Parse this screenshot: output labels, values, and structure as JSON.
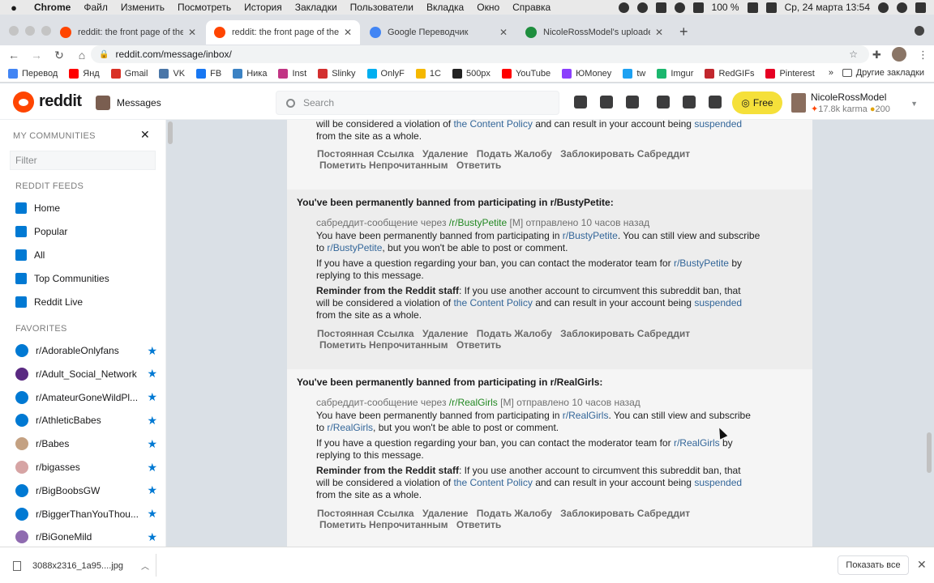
{
  "menubar": {
    "app": "Chrome",
    "items": [
      "Файл",
      "Изменить",
      "Посмотреть",
      "История",
      "Закладки",
      "Пользователи",
      "Вкладка",
      "Окно",
      "Справка"
    ],
    "battery": "100 %",
    "datetime": "Ср, 24 марта  13:54"
  },
  "tabs": [
    {
      "title": "reddit: the front page of the int",
      "color": "#ff4500"
    },
    {
      "title": "reddit: the front page of the int",
      "color": "#ff4500"
    },
    {
      "title": "Google Переводчик",
      "color": "#4285f4"
    },
    {
      "title": "NicoleRossModel's uploaded in",
      "color": "#1e8e3e"
    }
  ],
  "address": {
    "url": "reddit.com/message/inbox/"
  },
  "bookmarks": [
    {
      "label": "Перевод",
      "color": "#4285f4"
    },
    {
      "label": "Янд",
      "color": "#ff0000"
    },
    {
      "label": "Gmail",
      "color": "#d93025"
    },
    {
      "label": "VK",
      "color": "#4a76a8"
    },
    {
      "label": "FB",
      "color": "#1877f2"
    },
    {
      "label": "Ника",
      "color": "#3b82c4"
    },
    {
      "label": "Inst",
      "color": "#c13584"
    },
    {
      "label": "Slinky",
      "color": "#d32f2f"
    },
    {
      "label": "OnlyF",
      "color": "#00aff0"
    },
    {
      "label": "1С",
      "color": "#f5b800"
    },
    {
      "label": "500px",
      "color": "#222222"
    },
    {
      "label": "YouTube",
      "color": "#ff0000"
    },
    {
      "label": "ЮMoney",
      "color": "#8b3ffd"
    },
    {
      "label": "tw",
      "color": "#1da1f2"
    },
    {
      "label": "Imgur",
      "color": "#1bb76e"
    },
    {
      "label": "RedGIFs",
      "color": "#c1272d"
    },
    {
      "label": "Pinterest",
      "color": "#e60023"
    }
  ],
  "bookmarks_more": "»",
  "bookmarks_other": "Другие закладки",
  "reddit": {
    "logo_text": "reddit",
    "page": "Messages",
    "search_placeholder": "Search",
    "free_label": "Free",
    "username": "NicoleRossModel",
    "karma": "17.8k karma",
    "coins": "200"
  },
  "sidebar": {
    "my_communities": "MY COMMUNITIES",
    "filter_placeholder": "Filter",
    "feeds_title": "REDDIT FEEDS",
    "feeds": [
      "Home",
      "Popular",
      "All",
      "Top Communities",
      "Reddit Live"
    ],
    "favorites_title": "FAVORITES",
    "favorites": [
      {
        "name": "r/AdorableOnlyfans",
        "color": "#0079d3"
      },
      {
        "name": "r/Adult_Social_Network",
        "color": "#5a2a82"
      },
      {
        "name": "r/AmateurGoneWildPl...",
        "color": "#0079d3"
      },
      {
        "name": "r/AthleticBabes",
        "color": "#0079d3"
      },
      {
        "name": "r/Babes",
        "color": "#c4a182"
      },
      {
        "name": "r/bigasses",
        "color": "#d6a4a4"
      },
      {
        "name": "r/BigBoobsGW",
        "color": "#0079d3"
      },
      {
        "name": "r/BiggerThanYouThou...",
        "color": "#0079d3"
      },
      {
        "name": "r/BiGoneMild",
        "color": "#8f6bb0"
      }
    ]
  },
  "messages": [
    {
      "partial": true,
      "reminder_tail": "will be considered a violation of",
      "content_policy": "the Content Policy",
      "reminder_mid": "and can result in your account being",
      "suspended": "suspended",
      "reminder_end": "from the site as a whole.",
      "actions": [
        "Постоянная Ссылка",
        "Удаление",
        "Подать Жалобу",
        "Заблокировать Сабреддит"
      ],
      "actions2": [
        "Пометить Непрочитанным",
        "Ответить"
      ]
    },
    {
      "subject": "You've been permanently banned from participating in r/BustyPetite:",
      "meta_prefix": "сабреддит-сообщение через",
      "sub": "/r/BustyPetite",
      "meta_suffix": "[M] отправлено 10 часов назад",
      "body1a": "You have been permanently banned from participating in",
      "sublink": "r/BustyPetite",
      "body1b": ". You can still view and subscribe",
      "body2a": "to",
      "body2b": ", but you won't be able to post or comment.",
      "body3a": "If you have a question regarding your ban, you can contact the moderator team for",
      "body3b": "by",
      "body4": "replying to this message.",
      "reminder_label": "Reminder from the Reddit staff",
      "reminder": ": If you use another account to circumvent this subreddit ban, that",
      "reminder_tail": "will be considered a violation of",
      "content_policy": "the Content Policy",
      "reminder_mid": "and can result in your account being",
      "suspended": "suspended",
      "reminder_end": "from the site as a whole.",
      "actions": [
        "Постоянная Ссылка",
        "Удаление",
        "Подать Жалобу",
        "Заблокировать Сабреддит"
      ],
      "actions2": [
        "Пометить Непрочитанным",
        "Ответить"
      ]
    },
    {
      "subject": "You've been permanently banned from participating in r/RealGirls:",
      "meta_prefix": "сабреддит-сообщение через",
      "sub": "/r/RealGirls",
      "meta_suffix": "[M] отправлено 10 часов назад",
      "body1a": "You have been permanently banned from participating in",
      "sublink": "r/RealGirls",
      "body1b": ". You can still view and subscribe",
      "body2a": "to",
      "body2b": ", but you won't be able to post or comment.",
      "body3a": "If you have a question regarding your ban, you can contact the moderator team for",
      "body3b": "by",
      "body4": "replying to this message.",
      "reminder_label": "Reminder from the Reddit staff",
      "reminder": ": If you use another account to circumvent this subreddit ban, that",
      "reminder_tail": "will be considered a violation of",
      "content_policy": "the Content Policy",
      "reminder_mid": "and can result in your account being",
      "suspended": "suspended",
      "reminder_end": "from the site as a whole.",
      "actions": [
        "Постоянная Ссылка",
        "Удаление",
        "Подать Жалобу",
        "Заблокировать Сабреддит"
      ],
      "actions2": [
        "Пометить Непрочитанным",
        "Ответить"
      ]
    }
  ],
  "download": {
    "file": "3088x2316_1a95....jpg",
    "show_all": "Показать все"
  }
}
